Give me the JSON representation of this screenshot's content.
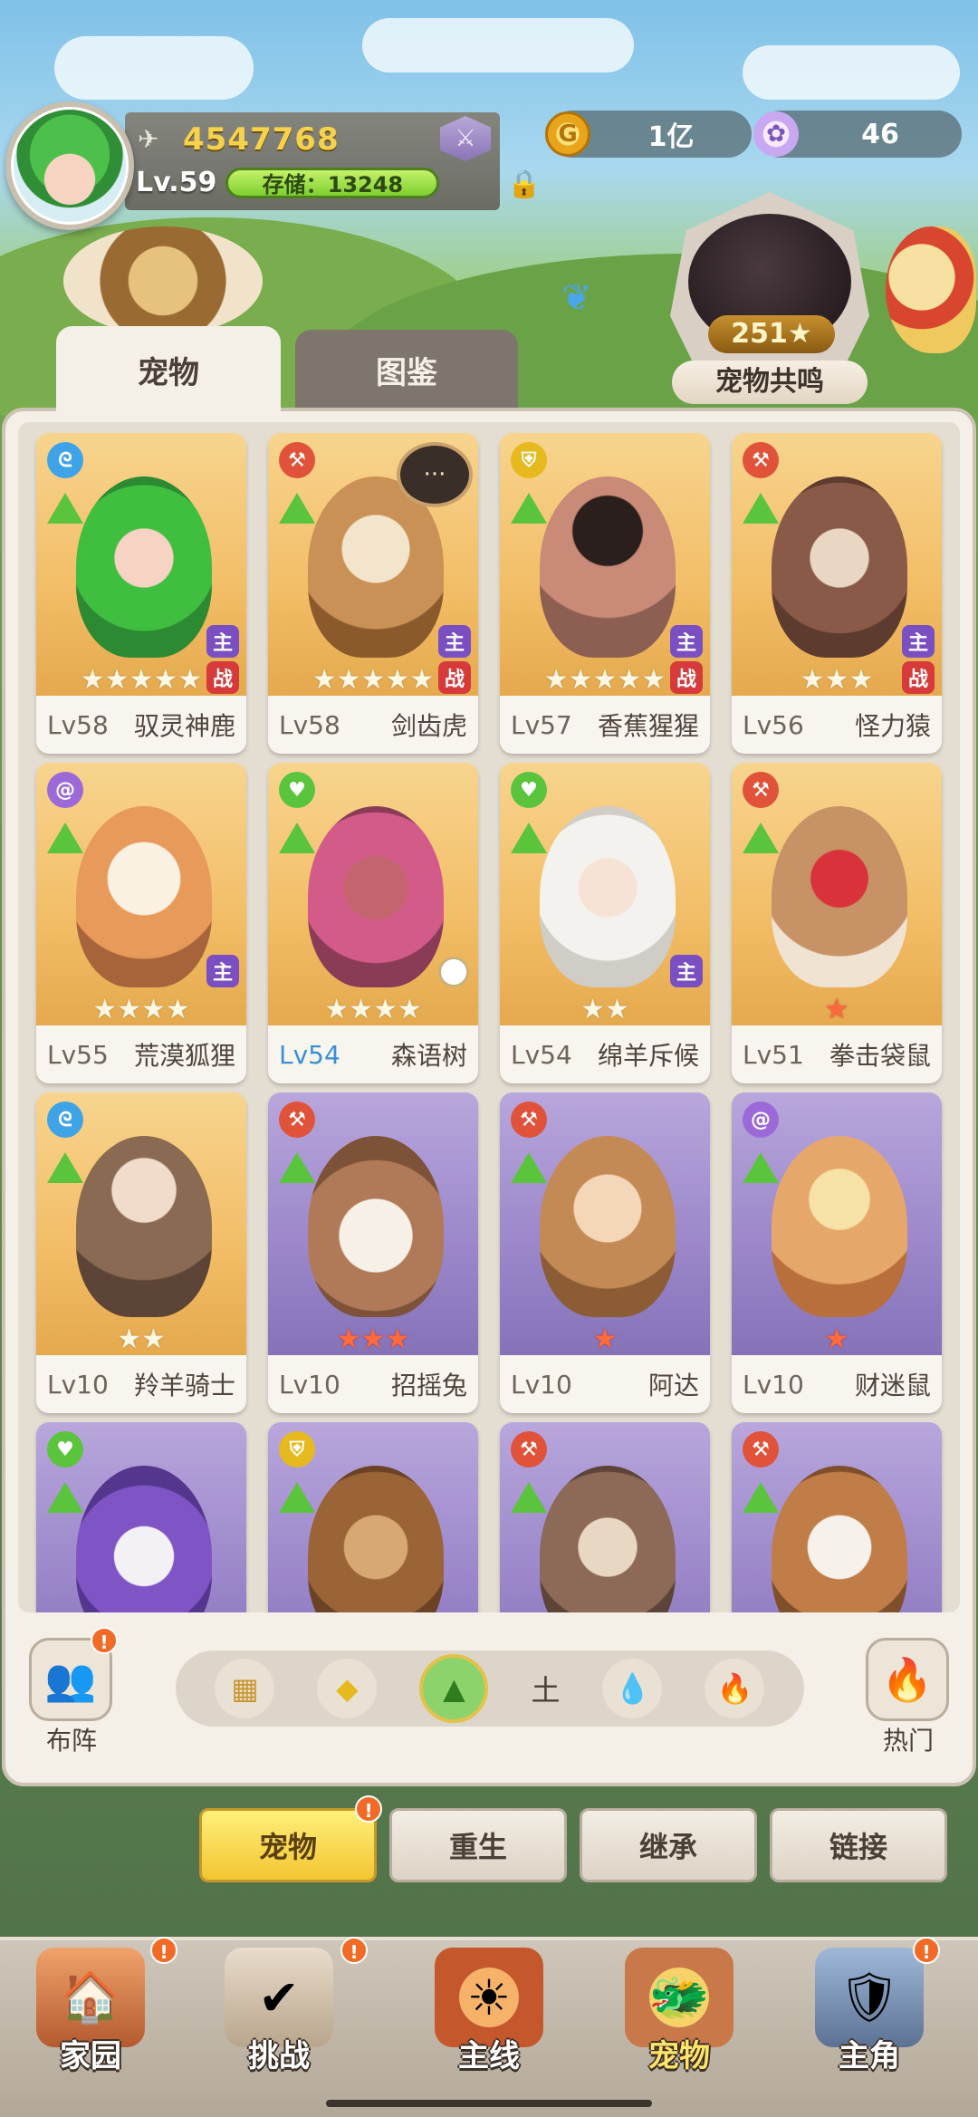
{
  "player": {
    "score": "4547768",
    "level": "Lv.59",
    "storage": "存储：13248"
  },
  "currencies": {
    "coin": "1亿",
    "shell": "46"
  },
  "resonance": {
    "count": "251",
    "label": "宠物共鸣"
  },
  "tabs": [
    {
      "label": "宠物",
      "active": true
    },
    {
      "label": "图鉴",
      "active": false
    }
  ],
  "pets": [
    {
      "name": "驭灵神鹿",
      "level": "Lv58",
      "stars": "★★★★★",
      "main": "主",
      "war": "战"
    },
    {
      "name": "剑齿虎",
      "level": "Lv58",
      "stars": "★★★★★",
      "main": "主",
      "war": "战"
    },
    {
      "name": "香蕉猩猩",
      "level": "Lv57",
      "stars": "★★★★★",
      "main": "主",
      "war": "战"
    },
    {
      "name": "怪力猿",
      "level": "Lv56",
      "stars": "★★★",
      "main": "主",
      "war": "战"
    },
    {
      "name": "荒漠狐狸",
      "level": "Lv55",
      "stars": "★★★★",
      "main": "主"
    },
    {
      "name": "森语树",
      "level": "Lv54",
      "stars": "★★★★"
    },
    {
      "name": "绵羊斥候",
      "level": "Lv54",
      "stars": "★★",
      "main": "主"
    },
    {
      "name": "拳击袋鼠",
      "level": "Lv51",
      "stars": "★"
    },
    {
      "name": "羚羊骑士",
      "level": "Lv10",
      "stars": "★★"
    },
    {
      "name": "招摇兔",
      "level": "Lv10",
      "stars": "★★★"
    },
    {
      "name": "阿达",
      "level": "Lv10",
      "stars": "★"
    },
    {
      "name": "财迷鼠",
      "level": "Lv10",
      "stars": "★"
    }
  ],
  "filter": {
    "current": "土"
  },
  "side_buttons": {
    "lineup": "布阵",
    "hot": "热门",
    "alert": "!"
  },
  "functions": [
    "宠物",
    "重生",
    "继承",
    "链接"
  ],
  "nav": [
    "家园",
    "挑战",
    "主线",
    "宠物",
    "主角"
  ],
  "colors": {
    "accent_gold": "#f2c531",
    "card_gold": "#f2bd66",
    "card_purple": "#9a86c9",
    "tag_main": "#7a4fc2",
    "tag_war": "#d63a3a"
  }
}
